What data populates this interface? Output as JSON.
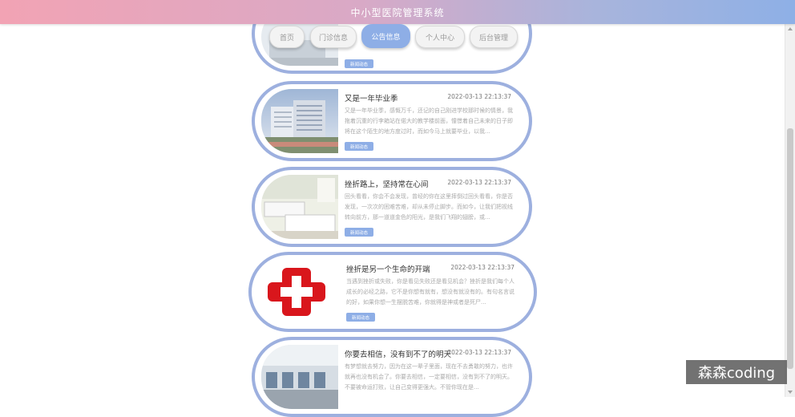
{
  "header": {
    "title": "中小型医院管理系统"
  },
  "nav": {
    "items": [
      {
        "label": "首页"
      },
      {
        "label": "门诊信息"
      },
      {
        "label": "公告信息"
      },
      {
        "label": "个人中心"
      },
      {
        "label": "后台管理"
      }
    ],
    "active": "公告信息"
  },
  "news": {
    "tag_label": "新闻动态",
    "items": [
      {
        "title": "又是一年毕业季",
        "date": "2022-03-13 22:13:37",
        "excerpt": "又是一年毕业季，感慨万千，还记的自己刚进学校那时候的情景，我拖着沉重的行李箱站在偌大的教学楼前面，憧憬着自己未来的日子即将在这个陌生的地方度过时，而如今马上就要毕业，以我..."
      },
      {
        "title": "挫折路上，坚持常在心间",
        "date": "2022-03-13 22:13:37",
        "excerpt": "回头看看，你会不会发现，曾经的你在这里摔倒过回头看看，你是否发现，一次次的困难苦难，却从未停止脚步。而如今，让我们把视线转向前方，那一道道金色的阳光，是我们飞翔的翅膀，或..."
      },
      {
        "title": "挫折是另一个生命的开端",
        "date": "2022-03-13 22:13:37",
        "excerpt": "当遇到挫折或失败，你是看见失败还是看见机会？挫折是我们每个人成长的必经之路，它不是你想有就有，想没有就没有的。有句名言说的好，如果你想一生摆脱苦难，你就得是神或者是死尸..."
      },
      {
        "title": "你要去相信，没有到不了的明天",
        "date": "2022-03-13 22:13:37",
        "excerpt": "有梦想就去努力，因为在这一辈子里面，现在不去勇敢的努力，也许就再也没有机会了。你要去相信，一定要相信，没有到不了的明天。不要被命运打败，让自己变得更强大。不管你现在是..."
      }
    ]
  },
  "watermark": {
    "text": "森森coding"
  }
}
